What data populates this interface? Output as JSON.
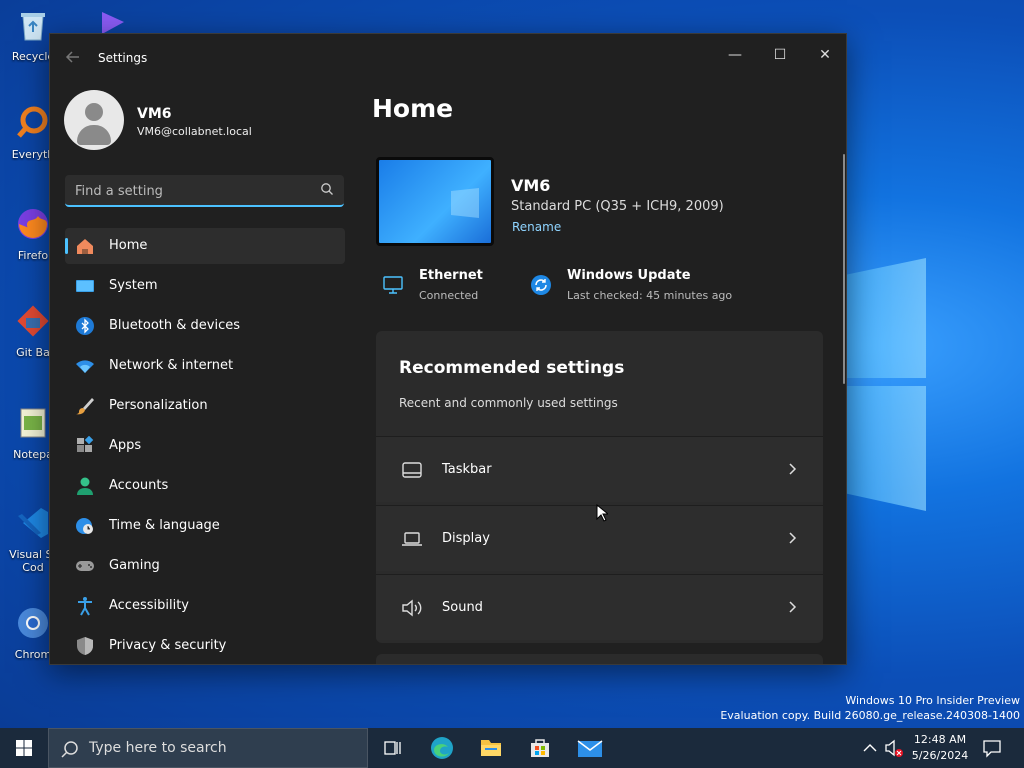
{
  "desktop": {
    "icons": [
      {
        "label": "Recycle"
      },
      {
        "label": "Everyth"
      },
      {
        "label": "Firefo"
      },
      {
        "label": "Git Ba"
      },
      {
        "label": "Notepa"
      },
      {
        "label": "Visual St Cod"
      },
      {
        "label": "Chrom"
      }
    ],
    "watermark": {
      "line1": "Windows 10 Pro Insider Preview",
      "line2": "Evaluation copy. Build 26080.ge_release.240308-1400"
    }
  },
  "window": {
    "title": "Settings",
    "controls": {
      "minimize": "—",
      "maximize": "☐",
      "close": "✕"
    }
  },
  "profile": {
    "name": "VM6",
    "email": "VM6@collabnet.local"
  },
  "search": {
    "placeholder": "Find a setting"
  },
  "sidebar": {
    "items": [
      {
        "label": "Home",
        "icon": "home-icon"
      },
      {
        "label": "System",
        "icon": "monitor-icon"
      },
      {
        "label": "Bluetooth & devices",
        "icon": "bluetooth-icon"
      },
      {
        "label": "Network & internet",
        "icon": "wifi-icon"
      },
      {
        "label": "Personalization",
        "icon": "brush-icon"
      },
      {
        "label": "Apps",
        "icon": "apps-icon"
      },
      {
        "label": "Accounts",
        "icon": "person-icon"
      },
      {
        "label": "Time & language",
        "icon": "globe-clock-icon"
      },
      {
        "label": "Gaming",
        "icon": "gamepad-icon"
      },
      {
        "label": "Accessibility",
        "icon": "accessibility-icon"
      },
      {
        "label": "Privacy & security",
        "icon": "shield-icon"
      }
    ]
  },
  "main": {
    "title": "Home",
    "device": {
      "name": "VM6",
      "model": "Standard PC (Q35 + ICH9, 2009)",
      "rename": "Rename"
    },
    "status": {
      "ethernet": {
        "title": "Ethernet",
        "sub": "Connected"
      },
      "update": {
        "title": "Windows Update",
        "sub": "Last checked: 45 minutes ago"
      }
    },
    "recommended": {
      "title": "Recommended settings",
      "subtitle": "Recent and commonly used settings",
      "rows": [
        {
          "label": "Taskbar",
          "icon": "taskbar-icon"
        },
        {
          "label": "Display",
          "icon": "laptop-icon"
        },
        {
          "label": "Sound",
          "icon": "speaker-icon"
        }
      ]
    }
  },
  "taskbar": {
    "search_placeholder": "Type here to search",
    "clock": {
      "time": "12:48 AM",
      "date": "5/26/2024"
    }
  },
  "colors": {
    "accent": "#4cc2ff",
    "window_bg": "#202020",
    "card_bg": "#2b2b2b"
  }
}
